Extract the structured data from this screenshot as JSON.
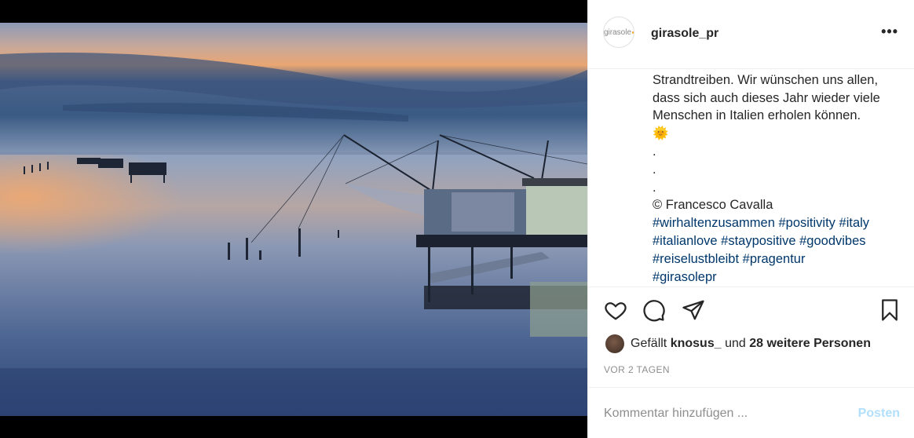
{
  "post": {
    "username": "girasole_pr",
    "avatar_text": "girasole",
    "more_icon": "more-horizontal-icon",
    "caption_lines": [
      "Strandtreiben. Wir wünschen uns allen,",
      "dass sich auch dieses Jahr wieder viele",
      "Menschen in Italien erholen können."
    ],
    "sun_emoji": "🌞",
    "dots": [
      ".",
      ".",
      "."
    ],
    "credit": "© Francesco Cavalla",
    "hashtag_lines": [
      "#wirhaltenzusammen #positivity #italy",
      "#italianlove #staypositive #goodvibes",
      "#reiselustbleibt #pragentur",
      "#girasolepr"
    ],
    "likes": {
      "prefix": "Gefällt",
      "user": "knosus_",
      "middle": "und",
      "others": "28 weitere Personen"
    },
    "time": "VOR 2 TAGEN",
    "comment_placeholder": "Kommentar hinzufügen ...",
    "post_button": "Posten"
  },
  "colors": {
    "text": "#262626",
    "hashtag": "#00376b",
    "muted": "#8e8e8e",
    "post_button": "#b2dffc"
  }
}
